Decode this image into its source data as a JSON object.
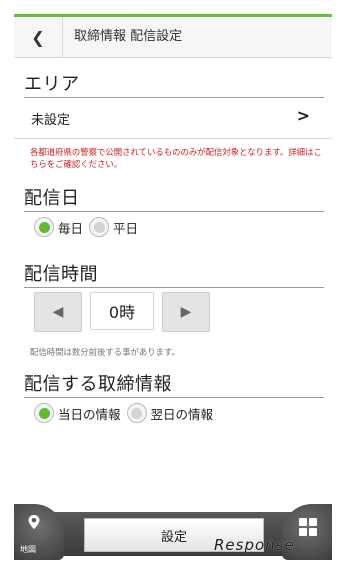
{
  "header": {
    "back_label": "❮",
    "title": "取締情報 配信設定"
  },
  "area": {
    "section_title": "エリア",
    "value": "未設定",
    "chevron": "›",
    "notice": "各都道府県の警察で公開されているもののみが配信対象となります。詳細はこちらをご確認ください。"
  },
  "delivery_day": {
    "section_title": "配信日",
    "options": [
      {
        "label": "毎日",
        "selected": true
      },
      {
        "label": "平日",
        "selected": false
      }
    ]
  },
  "delivery_time": {
    "section_title": "配信時間",
    "decrement": "◀",
    "value": "0時",
    "increment": "▶",
    "note": "配信時間は数分前後する事があります。"
  },
  "delivery_info": {
    "section_title": "配信する取締情報",
    "options": [
      {
        "label": "当日の情報",
        "selected": true
      },
      {
        "label": "翌日の情報",
        "selected": false
      }
    ]
  },
  "footer": {
    "map_label": "地図",
    "settings_label": "設定"
  },
  "watermark": "Response",
  "colors": {
    "accent": "#63b92f",
    "top_bar": "#6cbb3c",
    "notice": "#d11f1f"
  }
}
